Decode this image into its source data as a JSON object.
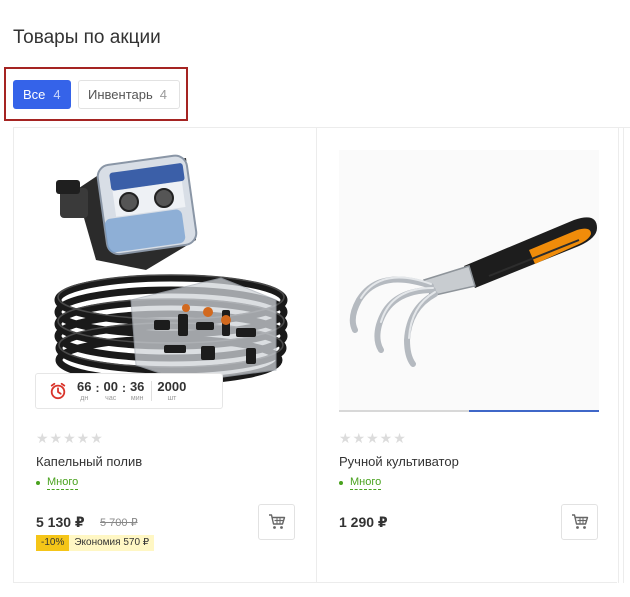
{
  "section": {
    "title": "Товары по акции"
  },
  "tabs": [
    {
      "label": "Все",
      "count": "4",
      "active": true
    },
    {
      "label": "Инвентарь",
      "count": "4",
      "active": false
    }
  ],
  "products": [
    {
      "name": "Капельный полив",
      "stars": "★★★★★",
      "stock": "Много",
      "price": "5 130 ₽",
      "old_price": "5 700 ₽",
      "discount_pct": "-10%",
      "discount_save": "Экономия 570 ₽",
      "timer": {
        "days": "66",
        "days_label": "дн",
        "hours": "00",
        "hours_label": "час",
        "minutes": "36",
        "minutes_label": "мин",
        "qty": "2000",
        "qty_label": "шт"
      },
      "image_icon": "drip-irrigation-kit-image"
    },
    {
      "name": "Ручной культиватор",
      "stars": "★★★★★",
      "stock": "Много",
      "price": "1 290 ₽",
      "image_icon": "hand-cultivator-image"
    }
  ],
  "colors": {
    "accent": "#3563e9",
    "highlight_border": "#a52422",
    "stock_green": "#49a21e",
    "discount_yellow": "#f5c518",
    "discount_light": "#fff7c4"
  }
}
